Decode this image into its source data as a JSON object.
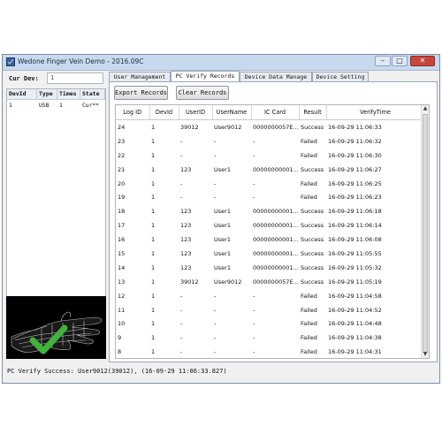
{
  "window": {
    "title": "Wedone Finger Vein Demo - 2016.09C",
    "minimize_label": "–",
    "maximize_label": "□",
    "close_label": "✕"
  },
  "left": {
    "cur_dev_label": "Cur Dev:",
    "cur_dev_value": "1",
    "device_columns": [
      "DevId",
      "Type",
      "Times",
      "State"
    ],
    "devices": [
      {
        "devid": "1",
        "type": "USB",
        "times": "1",
        "state": "Cur**"
      }
    ]
  },
  "tabs": [
    {
      "label": "User Management"
    },
    {
      "label": "PC Verify Records"
    },
    {
      "label": "Device Data Manage"
    },
    {
      "label": "Device Setting"
    }
  ],
  "toolbar": {
    "export_label": "Export Records",
    "clear_label": "Clear Records"
  },
  "records": {
    "columns": [
      "Log ID",
      "DevId",
      "UserID",
      "UserName",
      "IC Card",
      "Result",
      "VerifyTime"
    ],
    "rows": [
      [
        "24",
        "1",
        "39012",
        "User9012",
        "0000000057E...",
        "Success",
        "16-09-29 11:06:33"
      ],
      [
        "23",
        "1",
        "-",
        "-",
        "-",
        "Failed",
        "16-09-29 11:06:32"
      ],
      [
        "22",
        "1",
        "-",
        "-",
        "-",
        "Failed",
        "16-09-29 11:06:30"
      ],
      [
        "21",
        "1",
        "123",
        "User1",
        "00000000001...",
        "Success",
        "16-09-29 11:06:27"
      ],
      [
        "20",
        "1",
        "-",
        "-",
        "-",
        "Failed",
        "16-09-29 11:06:25"
      ],
      [
        "19",
        "1",
        "-",
        "-",
        "-",
        "Failed",
        "16-09-29 11:06:23"
      ],
      [
        "18",
        "1",
        "123",
        "User1",
        "00000000001...",
        "Success",
        "16-09-29 11:06:18"
      ],
      [
        "17",
        "1",
        "123",
        "User1",
        "00000000001...",
        "Success",
        "16-09-29 11:06:14"
      ],
      [
        "16",
        "1",
        "123",
        "User1",
        "00000000001...",
        "Success",
        "16-09-29 11:06:08"
      ],
      [
        "15",
        "1",
        "123",
        "User1",
        "00000000001...",
        "Success",
        "16-09-29 11:05:55"
      ],
      [
        "14",
        "1",
        "123",
        "User1",
        "00000000001...",
        "Success",
        "16-09-29 11:05:32"
      ],
      [
        "13",
        "1",
        "39012",
        "User9012",
        "0000000057E...",
        "Success",
        "16-09-29 11:05:19"
      ],
      [
        "12",
        "1",
        "-",
        "-",
        "-",
        "Failed",
        "16-09-29 11:04:58"
      ],
      [
        "11",
        "1",
        "-",
        "-",
        "-",
        "Failed",
        "16-09-29 11:04:52"
      ],
      [
        "10",
        "1",
        "-",
        "-",
        "-",
        "Failed",
        "16-09-29 11:04:48"
      ],
      [
        "9",
        "1",
        "-",
        "-",
        "-",
        "Failed",
        "16-09-29 11:04:38"
      ],
      [
        "8",
        "1",
        "-",
        "-",
        "-",
        "Failed",
        "16-09-29 11:04:31"
      ]
    ]
  },
  "status": {
    "message": "PC Verify Success: User9012(39012), (16-09-29 11:06:33.827)"
  },
  "colors": {
    "titlebar": "#c7d9ef",
    "window_border": "#7b8ea6",
    "check_green": "#3fb33b"
  }
}
